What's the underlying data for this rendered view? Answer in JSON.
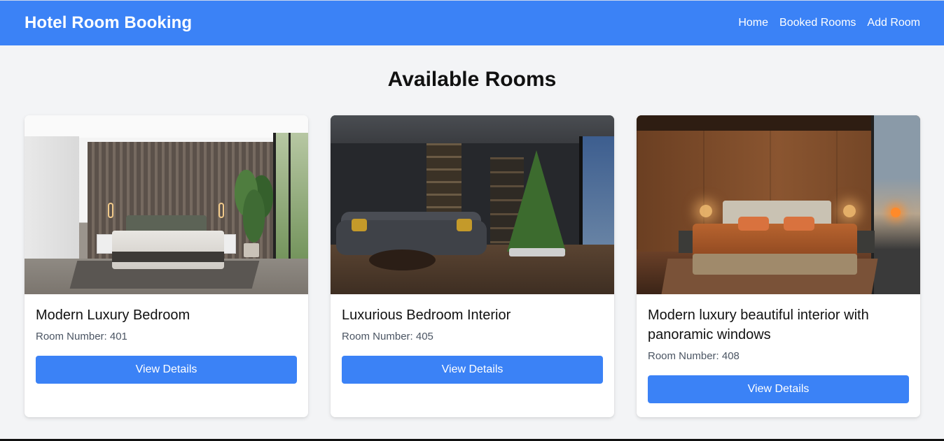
{
  "header": {
    "brand": "Hotel Room Booking",
    "nav": [
      {
        "label": "Home"
      },
      {
        "label": "Booked Rooms"
      },
      {
        "label": "Add Room"
      }
    ]
  },
  "main": {
    "title": "Available Rooms",
    "rooms": [
      {
        "title": "Modern Luxury Bedroom",
        "room_number": "Room Number: 401",
        "button": "View Details"
      },
      {
        "title": "Luxurious Bedroom Interior",
        "room_number": "Room Number: 405",
        "button": "View Details"
      },
      {
        "title": "Modern luxury beautiful interior with panoramic windows",
        "room_number": "Room Number: 408",
        "button": "View Details"
      }
    ]
  },
  "colors": {
    "accent": "#3b82f6",
    "background": "#f3f4f6",
    "muted_text": "#4b5563"
  }
}
